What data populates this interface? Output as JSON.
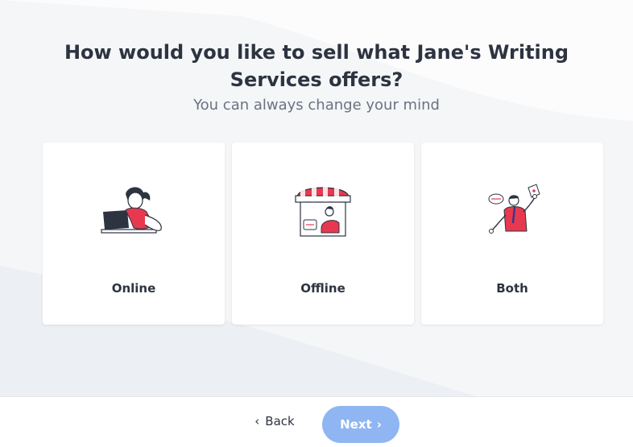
{
  "header": {
    "title": "How would you like to sell what Jane's Writing Services offers?",
    "subtitle": "You can always change your mind"
  },
  "options": [
    {
      "label": "Online",
      "icon": "woman-laptop-illustration"
    },
    {
      "label": "Offline",
      "icon": "storefront-illustration"
    },
    {
      "label": "Both",
      "icon": "man-shopping-illustration"
    }
  ],
  "footer": {
    "back_label": "Back",
    "back_icon": "chevron-left-icon",
    "next_label": "Next",
    "next_icon": "chevron-right-icon"
  },
  "colors": {
    "accent_red": "#e8384f",
    "next_button_bg": "#8fb6f2",
    "ink": "#2d3340"
  }
}
